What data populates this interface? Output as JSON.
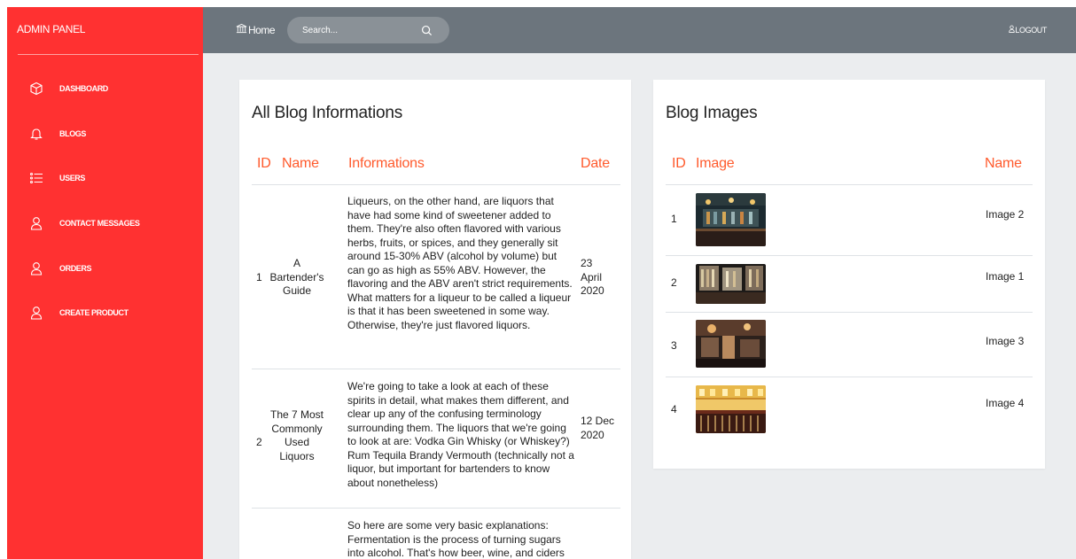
{
  "sidebar": {
    "brand": "ADMIN PANEL",
    "items": [
      {
        "label": "DASHBOARD",
        "icon": "cube-icon"
      },
      {
        "label": "BLOGS",
        "icon": "bell-icon"
      },
      {
        "label": "USERS",
        "icon": "list-icon"
      },
      {
        "label": "CONTACT MESSAGES",
        "icon": "user-icon"
      },
      {
        "label": "ORDERS",
        "icon": "user-icon"
      },
      {
        "label": "CREATE PRODUCT",
        "icon": "user-icon"
      }
    ]
  },
  "topbar": {
    "home_label": "Home",
    "search_placeholder": "Search...",
    "logout_label": "LOGOUT"
  },
  "blogs_card": {
    "title": "All Blog Informations",
    "headers": {
      "id": "ID",
      "name": "Name",
      "info": "Informations",
      "date": "Date"
    },
    "rows": [
      {
        "id": "1",
        "name": "A Bartender's Guide",
        "info": "Liqueurs, on the other hand, are liquors that have had some kind of sweetener added to them. They're also often flavored with various herbs, fruits, or spices, and they generally sit around 15-30% ABV (alcohol by volume) but can go as high as 55% ABV. However, the flavoring and the ABV aren't strict requirements. What matters for a liqueur to be called a liqueur is that it has been sweetened in some way. Otherwise, they're just flavored liquors.",
        "date": "23 April 2020"
      },
      {
        "id": "2",
        "name": "The 7 Most Commonly Used Liquors",
        "info": "We're going to take a look at each of these spirits in detail, what makes them different, and clear up any of the confusing terminology surrounding them. The liquors that we're going to look at are: Vodka Gin Whisky (or Whiskey?) Rum Tequila Brandy Vermouth (technically not a liquor, but important for bartenders to know about nonetheless)",
        "date": "12 Dec 2020"
      },
      {
        "id": "",
        "name": "",
        "info": "So here are some very basic explanations: Fermentation is the process of turning sugars into alcohol. That's how beer, wine, and ciders",
        "date": ""
      }
    ]
  },
  "images_card": {
    "title": "Blog Images",
    "headers": {
      "id": "ID",
      "image": "Image",
      "name": "Name"
    },
    "rows": [
      {
        "id": "1",
        "name": "Image 2"
      },
      {
        "id": "2",
        "name": "Image 1"
      },
      {
        "id": "3",
        "name": "Image 3"
      },
      {
        "id": "4",
        "name": "Image 4"
      }
    ]
  },
  "colors": {
    "sidebar": "#ff3131",
    "topbar": "#6c757d",
    "accent": "#ff5a2c",
    "background": "#ebedef"
  }
}
